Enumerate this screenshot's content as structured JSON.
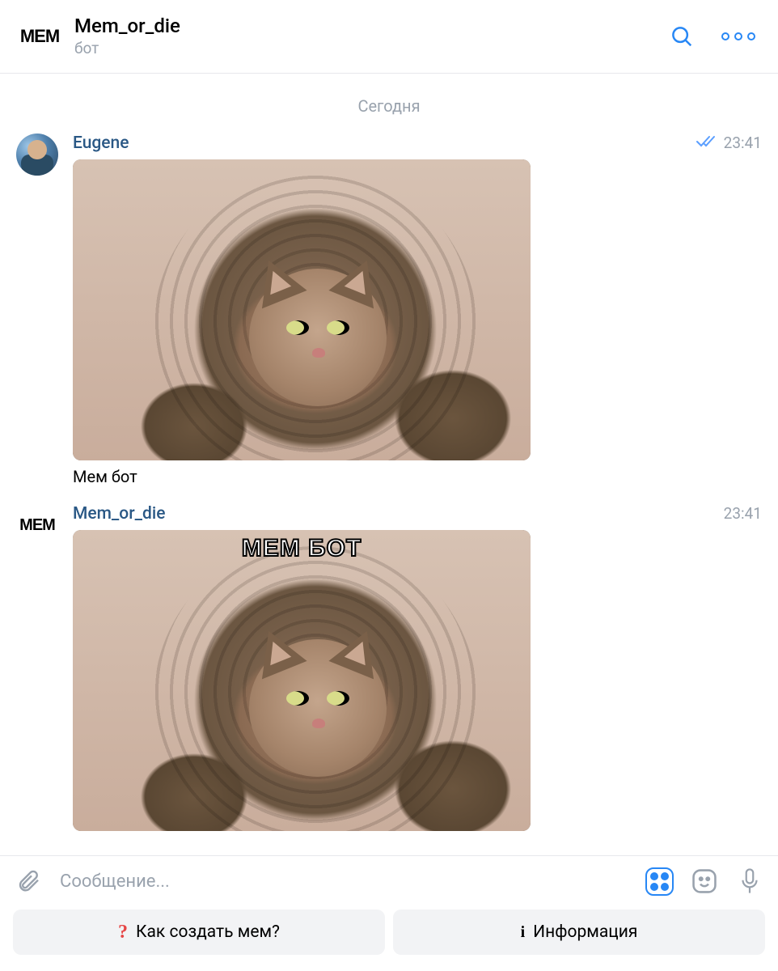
{
  "header": {
    "title": "Mem_or_die",
    "subtitle": "бот",
    "logo_text": "MEM"
  },
  "date_separator": "Сегодня",
  "messages": [
    {
      "sender": "Eugene",
      "time": "23:41",
      "read": true,
      "caption": "Мем бот",
      "meme_overlay": ""
    },
    {
      "sender": "Mem_or_die",
      "time": "23:41",
      "read": false,
      "caption": "",
      "meme_overlay": "МЕМ БОТ"
    }
  ],
  "composer": {
    "placeholder": "Сообщение..."
  },
  "quick_buttons": {
    "how_label": "Как создать мем?",
    "info_label": "Информация"
  }
}
